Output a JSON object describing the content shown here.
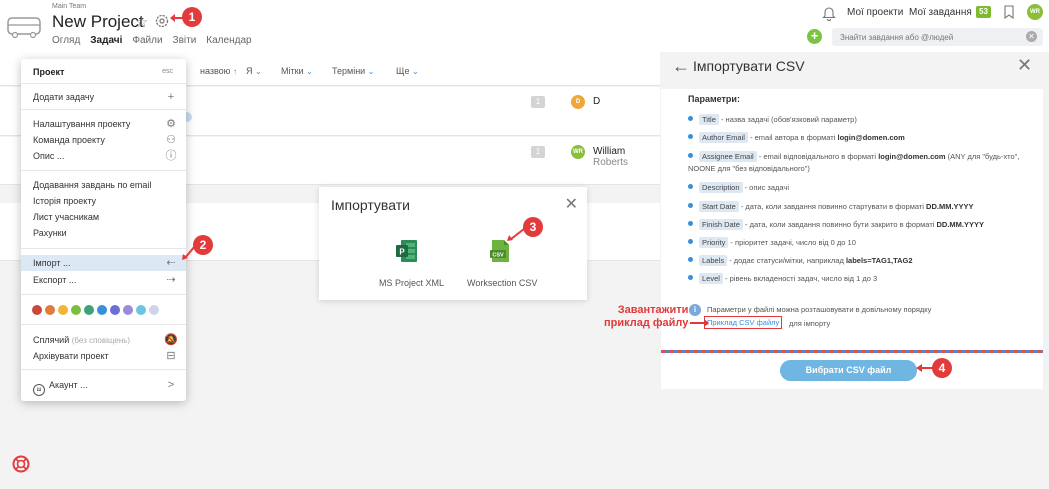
{
  "header": {
    "team_name": "Main Team",
    "project_title": "New Project",
    "tabs": [
      "Огляд",
      "Задачі",
      "Файли",
      "Звіти",
      "Календар"
    ],
    "active_tab": "Задачі",
    "my_projects": "Мої проекти",
    "my_tasks": "Мої завдання",
    "tasks_count": "53",
    "avatar_initials": "WR",
    "search_placeholder": "Знайти завдання або @людей",
    "plus_label": "+"
  },
  "filters": {
    "sort_label": "назвою",
    "sort_arrow": "↑",
    "items": [
      "Я",
      "Мітки",
      "Терміни",
      "Ще"
    ]
  },
  "tasks": [
    {
      "num": "1",
      "avatar": "D",
      "assignee": "D",
      "assignee_muted": ""
    },
    {
      "num": "1",
      "avatar": "WR",
      "assignee": "William",
      "assignee_muted": "Roberts"
    }
  ],
  "menu": {
    "header": "Проект",
    "esc": "esc",
    "add_task": "Додати задачу",
    "add_task_icon": "+",
    "settings": "Налаштування проекту",
    "team": "Команда проекту",
    "description": "Опис ...",
    "email_tasks": "Додавання завдань по email",
    "history": "Історія проекту",
    "letter": "Лист учасникам",
    "invoices": "Рахунки",
    "import": "Імпорт ...",
    "export": "Експорт ...",
    "colors": [
      "#c94a3a",
      "#e07b39",
      "#f0b43a",
      "#7cbf3e",
      "#3aa37a",
      "#3b8fd8",
      "#6a6fd3",
      "#9b8bd9",
      "#6cc5e0",
      "#d0d4ea"
    ],
    "sleeping": "Сплячий",
    "sleeping_note": "(без сповіщень)",
    "archive": "Архівувати проект",
    "account": "Акаунт ...",
    "account_arrow": ">"
  },
  "import_modal": {
    "title": "Імпортувати",
    "ms_project": "MS Project XML",
    "worksection": "Worksection CSV",
    "csv_badge": "CSV",
    "ms_badge": "P"
  },
  "panel": {
    "title": "Імпортувати CSV",
    "params_header": "Параметри:",
    "params": [
      {
        "tag": "Title",
        "text": " - назва задачі (обов'язковий параметр)",
        "bold": "",
        "tail": ""
      },
      {
        "tag": "Author Email",
        "text": " - email автора в форматі ",
        "bold": "login@domen.com",
        "tail": ""
      },
      {
        "tag": "Assignee Email",
        "text": " - email відповідального в форматі ",
        "bold": "login@domen.com",
        "tail": " (ANY для \"будь-хто\", NOONE для \"без відповідального\")"
      },
      {
        "tag": "Description",
        "text": " - опис задачі",
        "bold": "",
        "tail": ""
      },
      {
        "tag": "Start Date",
        "text": " - дата, коли завдання повинно стартувати в форматі ",
        "bold": "DD.MM.YYYY",
        "tail": ""
      },
      {
        "tag": "Finish Date",
        "text": " - дата, коли завдання повинно бути закрито в форматі ",
        "bold": "DD.MM.YYYY",
        "tail": ""
      },
      {
        "tag": "Priority",
        "text": " - пріоритет задачі, число від 0 до 10",
        "bold": "",
        "tail": ""
      },
      {
        "tag": "Labels",
        "text": " - додає статуси/мітки, наприклад ",
        "bold": "labels=TAG1,TAG2",
        "tail": ""
      },
      {
        "tag": "Level",
        "text": " - рівень вкладеності задач, число від 1 до 3",
        "bold": "",
        "tail": ""
      }
    ],
    "info_text": "Параметри у файлі можна розташовувати в довільному порядку",
    "example_link": "Приклад CSV файлу",
    "example_suffix": "для імпорту",
    "choose_button": "Вибрати CSV файл"
  },
  "annotations": {
    "download_note_line1": "Завантажити",
    "download_note_line2": "приклад файлу",
    "steps": [
      "1",
      "2",
      "3",
      "4"
    ]
  }
}
